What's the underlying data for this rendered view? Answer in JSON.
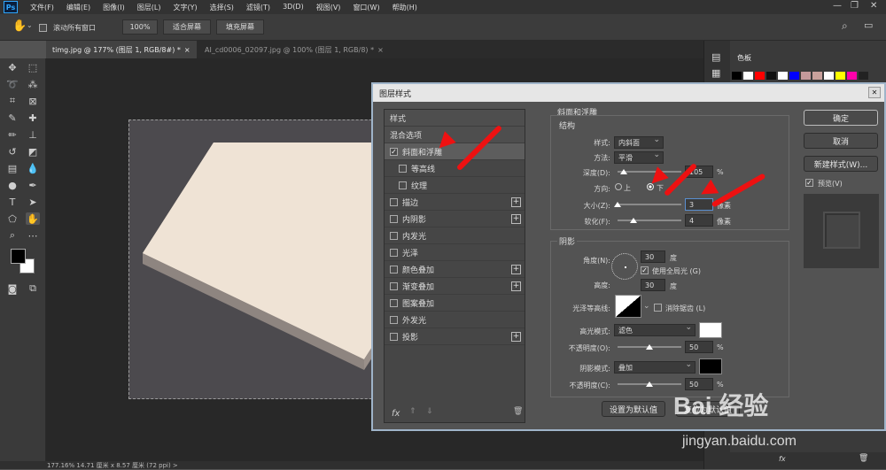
{
  "menubar": {
    "logo": "Ps",
    "items": [
      "文件(F)",
      "编辑(E)",
      "图像(I)",
      "图层(L)",
      "文字(Y)",
      "选择(S)",
      "滤镜(T)",
      "3D(D)",
      "视图(V)",
      "窗口(W)",
      "帮助(H)"
    ]
  },
  "options": {
    "scroll_all": "滚动所有窗口",
    "zoom": "100%",
    "fit_screen": "适合屏幕",
    "fill_screen": "填充屏幕"
  },
  "tabs": [
    {
      "label": "timg.jpg @ 177% (图层 1, RGB/8#) *",
      "close": "×"
    },
    {
      "label": "AI_cd0006_02097.jpg @ 100% (图层 1, RGB/8) *",
      "close": "×"
    }
  ],
  "status": {
    "text": "177.16%   14.71 厘米 x 8.57 厘米 (72 ppi)   >"
  },
  "swatches_panel": {
    "title": "色板"
  },
  "dialog": {
    "title": "图层样式",
    "close": "✕",
    "style_list": {
      "header": "样式",
      "blend": "混合选项",
      "items": [
        {
          "label": "斜面和浮雕",
          "checked": true,
          "indent": false,
          "plus": false
        },
        {
          "label": "等高线",
          "checked": false,
          "indent": true,
          "plus": false
        },
        {
          "label": "纹理",
          "checked": false,
          "indent": true,
          "plus": false
        },
        {
          "label": "描边",
          "checked": false,
          "indent": false,
          "plus": true
        },
        {
          "label": "内阴影",
          "checked": false,
          "indent": false,
          "plus": true
        },
        {
          "label": "内发光",
          "checked": false,
          "indent": false,
          "plus": false
        },
        {
          "label": "光泽",
          "checked": false,
          "indent": false,
          "plus": false
        },
        {
          "label": "颜色叠加",
          "checked": false,
          "indent": false,
          "plus": true
        },
        {
          "label": "渐变叠加",
          "checked": false,
          "indent": false,
          "plus": true
        },
        {
          "label": "图案叠加",
          "checked": false,
          "indent": false,
          "plus": false
        },
        {
          "label": "外发光",
          "checked": false,
          "indent": false,
          "plus": false
        },
        {
          "label": "投影",
          "checked": false,
          "indent": false,
          "plus": true
        }
      ],
      "fx": "fx"
    },
    "bevel": {
      "title": "斜面和浮雕",
      "structure_title": "结构",
      "style_label": "样式:",
      "style_value": "内斜面",
      "method_label": "方法:",
      "method_value": "平滑",
      "depth_label": "深度(D):",
      "depth_value": "105",
      "depth_unit": "%",
      "depth_level": 0.1,
      "direction_label": "方向:",
      "dir_up": "上",
      "dir_down": "下",
      "size_label": "大小(Z):",
      "size_value": "3",
      "size_unit": "像素",
      "size_level": 0.0,
      "soften_label": "软化(F):",
      "soften_value": "4",
      "soften_unit": "像素",
      "soften_level": 0.25
    },
    "shading": {
      "title": "阴影",
      "angle_label": "角度(N):",
      "angle_value": "30",
      "angle_unit": "度",
      "global_light": "使用全局光 (G)",
      "altitude_label": "高度:",
      "altitude_value": "30",
      "altitude_unit": "度",
      "gloss_label": "光泽等高线:",
      "antialias": "消除锯齿 (L)",
      "highlight_label": "高光模式:",
      "highlight_value": "滤色",
      "highlight_color": "#ffffff",
      "hl_opacity_label": "不透明度(O):",
      "hl_opacity_value": "50",
      "hl_opacity_unit": "%",
      "hl_opacity_level": 0.5,
      "shadow_label": "阴影模式:",
      "shadow_value": "叠加",
      "shadow_color": "#000000",
      "sh_opacity_label": "不透明度(C):",
      "sh_opacity_value": "50",
      "sh_opacity_unit": "%",
      "sh_opacity_level": 0.5
    },
    "buttons": {
      "set_default": "设置为默认值",
      "reset_default": "复位为默认值",
      "ok": "确定",
      "cancel": "取消",
      "new_style": "新建样式(W)...",
      "preview": "预览(V)"
    }
  },
  "watermark": {
    "logo": "Bai 经验",
    "url": "jingyan.baidu.com"
  },
  "colors": {
    "arrow": "#ee1111",
    "paper": "#efe3d5",
    "dialog_border": "#9fb4c9"
  }
}
